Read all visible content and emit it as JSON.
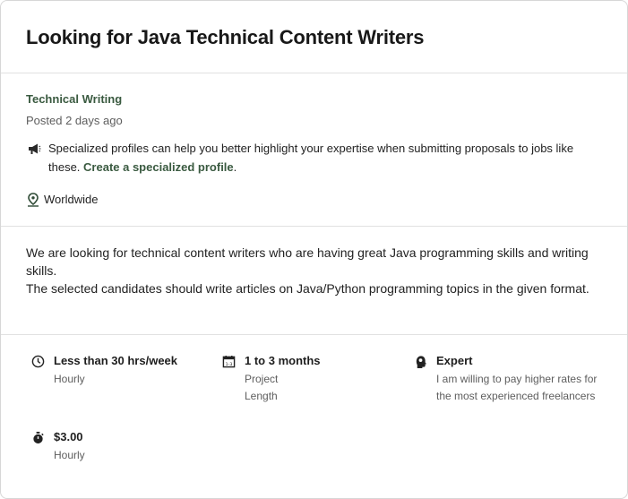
{
  "job": {
    "title": "Looking for Java Technical Content Writers",
    "category": "Technical Writing",
    "posted": "Posted 2 days ago",
    "notice_text": "Specialized profiles can help you better highlight your expertise when submitting proposals to jobs like these. ",
    "notice_link": "Create a specialized profile",
    "notice_end": ".",
    "location": "Worldwide",
    "description": [
      "We are looking for technical content writers who are having great Java programming skills and writing skills.",
      "The selected candidates should write articles on Java/Python programming topics in the given format."
    ]
  },
  "features": {
    "hours": {
      "main": "Less than 30 hrs/week",
      "sub": "Hourly",
      "icon": "clock-icon"
    },
    "length": {
      "main": "1 to 3 months",
      "sub": "Project Length",
      "icon": "calendar-icon"
    },
    "level": {
      "main": "Expert",
      "sub": "I am willing to pay higher rates for the most experienced freelancers",
      "icon": "brain-head-icon"
    },
    "rate": {
      "main": "$3.00",
      "sub": "Hourly",
      "icon": "stopwatch-icon"
    }
  },
  "colors": {
    "accent": "#3a5a40",
    "text": "#1b1b1b",
    "muted": "#5e5e5e",
    "divider": "#e1e1e1"
  }
}
